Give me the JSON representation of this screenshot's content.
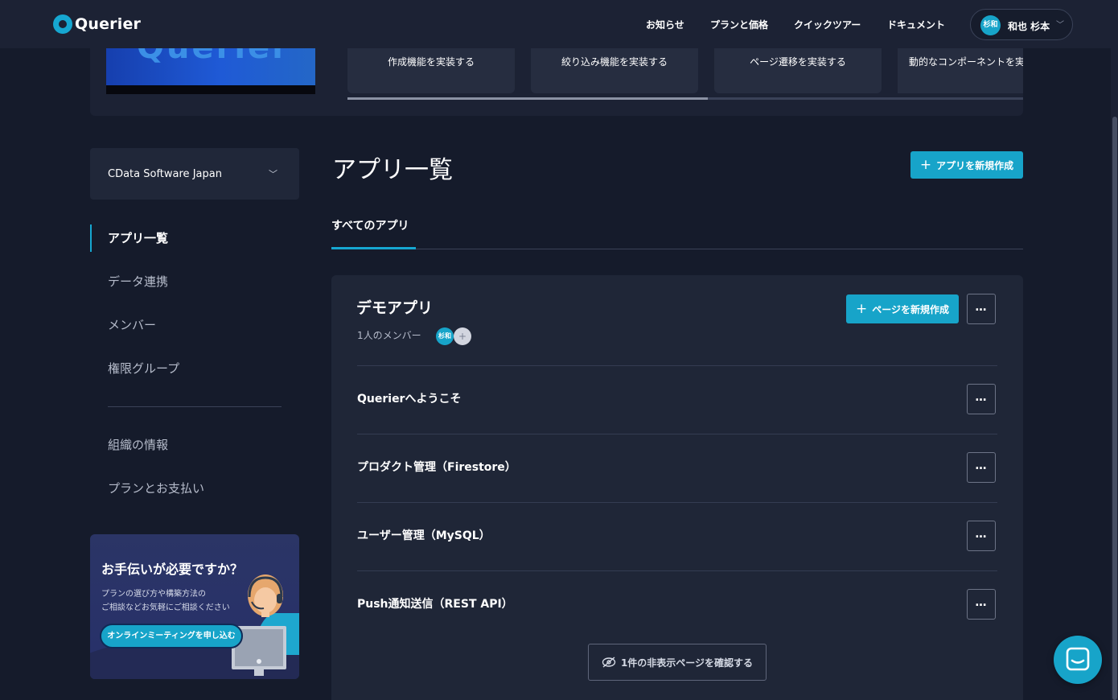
{
  "brand": {
    "name": "Querier",
    "accent": "#16a7d1"
  },
  "nav": {
    "links": [
      "お知らせ",
      "プランと価格",
      "クイックツアー",
      "ドキュメント"
    ],
    "user": {
      "initials": "杉和",
      "name": "和也 杉本"
    }
  },
  "tutorial": {
    "cards": [
      "作成機能を実装する",
      "絞り込み機能を実装する",
      "ページ遷移を実装する",
      "動的なコンポーネントを実装する"
    ]
  },
  "sidebar": {
    "org": "CData Software Japan",
    "items": [
      "アプリ一覧",
      "データ連携",
      "メンバー",
      "権限グループ"
    ],
    "items2": [
      "組織の情報",
      "プランとお支払い"
    ],
    "help": {
      "title": "お手伝いが必要ですか？",
      "line1": "プランの選び方や構築方法の",
      "line2": "ご相談などお気軽にご相談ください",
      "button": "オンラインミーティングを申し込む"
    }
  },
  "main": {
    "title": "アプリ一覧",
    "new_app_button": "アプリを新規作成",
    "tab_all": "すべてのアプリ"
  },
  "app": {
    "name": "デモアプリ",
    "members": "1人のメンバー",
    "member_initials": "杉和",
    "add_member": "+",
    "new_page_button": "ページを新規作成",
    "pages": [
      "Querierへようこそ",
      "プロダクト管理（Firestore）",
      "ユーザー管理（MySQL）",
      "Push通知送信（REST API）"
    ],
    "hidden_pages_button": "1件の非表示ページを確認する"
  },
  "icons": {
    "more": "…",
    "plus": "+",
    "caret": "﹀"
  }
}
